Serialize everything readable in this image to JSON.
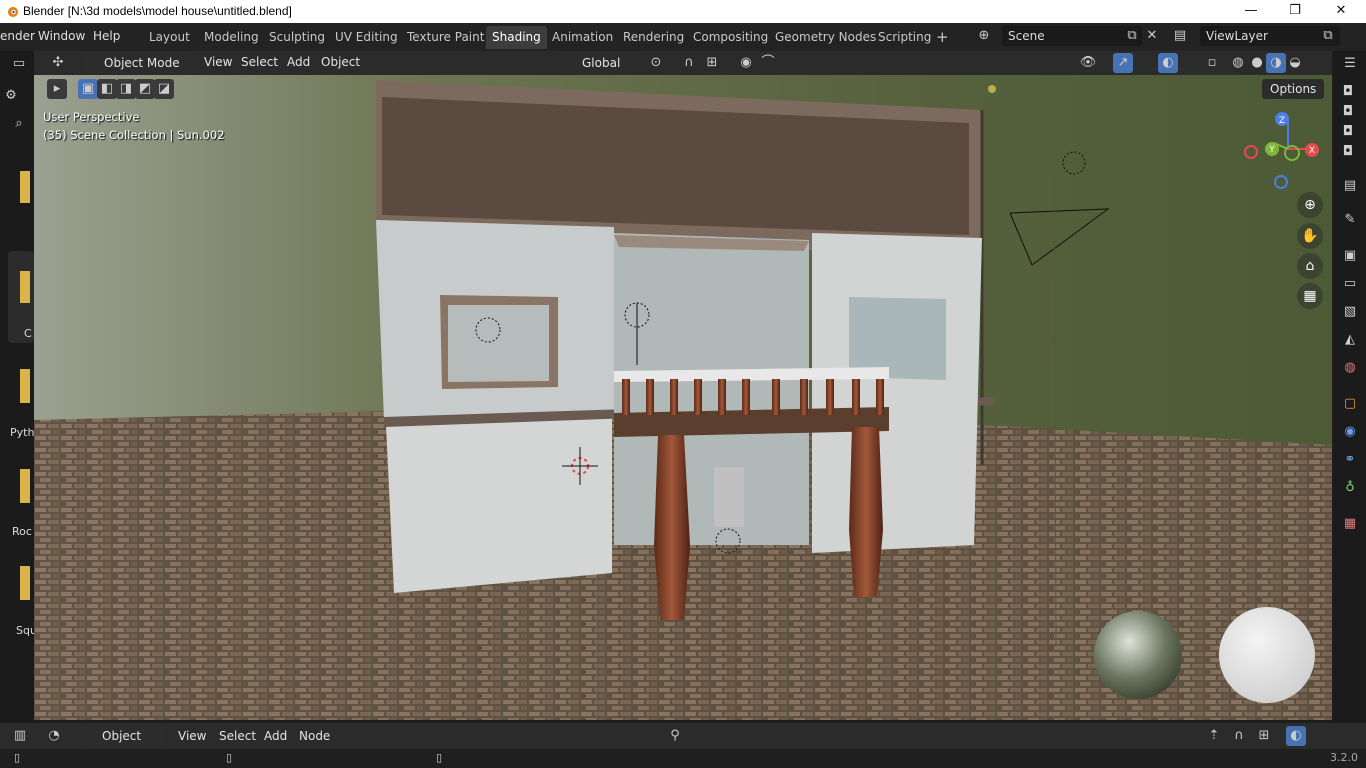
{
  "window": {
    "title": "Blender [N:\\3d models\\model house\\untitled.blend]",
    "minimize": "—",
    "maximize": "❐",
    "close": "✕"
  },
  "menus": [
    "ender",
    "Window",
    "Help"
  ],
  "workspaces": {
    "tabs": [
      "Layout",
      "Modeling",
      "Sculpting",
      "UV Editing",
      "Texture Paint",
      "Shading",
      "Animation",
      "Rendering",
      "Compositing",
      "Geometry Nodes",
      "Scripting"
    ],
    "active": "Shading",
    "add": "+"
  },
  "scene": {
    "label": "Scene",
    "view_layer": "ViewLayer"
  },
  "viewport_header": {
    "mode": "Object Mode",
    "menus": [
      "View",
      "Select",
      "Add",
      "Object"
    ],
    "transform_orientation": "Global",
    "options": "Options"
  },
  "viewport_overlay": {
    "perspective": "User Perspective",
    "collection": "(35) Scene Collection | Sun.002"
  },
  "gizmo": {
    "z": "Z",
    "y": "Y",
    "x": "X"
  },
  "left_strip_labels": [
    "C",
    "Pyth",
    "Roc",
    "Squ"
  ],
  "bottom_header": {
    "mode": "Object",
    "menus": [
      "View",
      "Select",
      "Add",
      "Node"
    ]
  },
  "status": {
    "version": "3.2.0"
  },
  "colors": {
    "accent_blue": "#4772b3",
    "axis_x": "#e34c4c",
    "axis_y": "#7eb83a",
    "axis_z": "#4c7ee3"
  }
}
